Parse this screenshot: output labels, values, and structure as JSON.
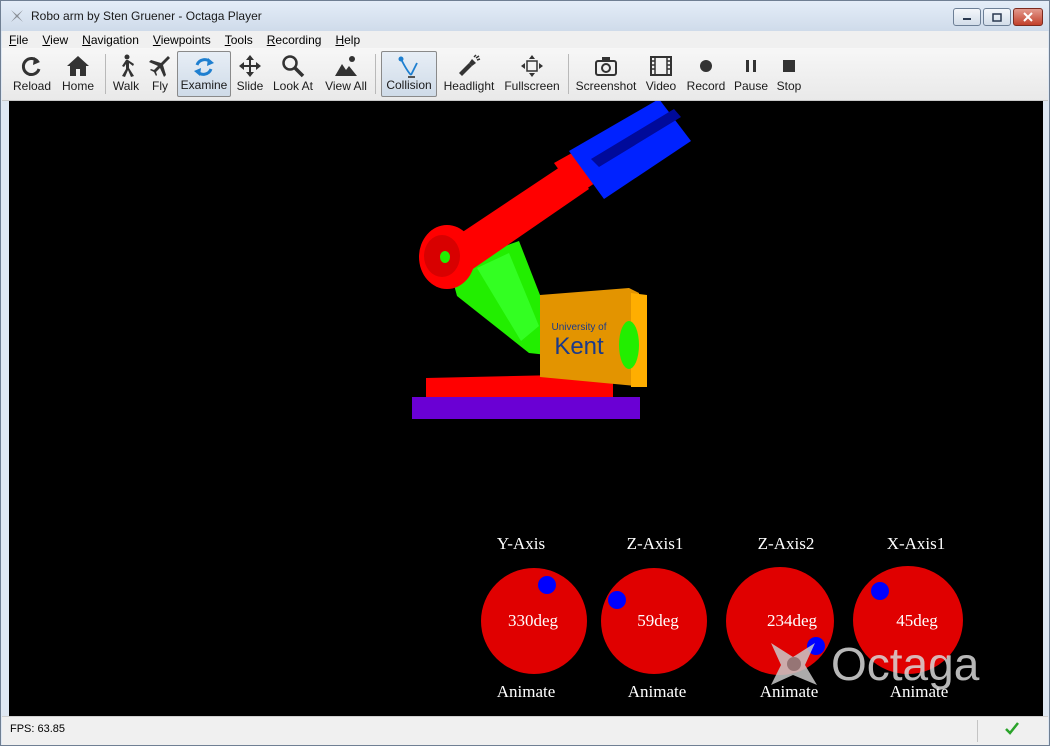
{
  "window": {
    "title": "Robo arm by Sten Gruener - Octaga Player"
  },
  "menu": [
    "File",
    "View",
    "Navigation",
    "Viewpoints",
    "Tools",
    "Recording",
    "Help"
  ],
  "toolbar": {
    "reload": "Reload",
    "home": "Home",
    "walk": "Walk",
    "fly": "Fly",
    "examine": "Examine",
    "slide": "Slide",
    "look_at": "Look At",
    "view_all": "View All",
    "collision": "Collision",
    "headlight": "Headlight",
    "fullscreen": "Fullscreen",
    "screenshot": "Screenshot",
    "video": "Video",
    "record": "Record",
    "pause": "Pause",
    "stop": "Stop"
  },
  "scene": {
    "logo_text": "University of Kent",
    "watermark": "Octaga",
    "dials": [
      {
        "axis": "Y-Axis",
        "value": "330deg",
        "animate": "Animate"
      },
      {
        "axis": "Z-Axis1",
        "value": "59deg",
        "animate": "Animate"
      },
      {
        "axis": "Z-Axis2",
        "value": "234deg",
        "animate": "Animate"
      },
      {
        "axis": "X-Axis1",
        "value": "45deg",
        "animate": "Animate"
      }
    ],
    "colors": {
      "background": "#000000",
      "arm_red": "#ff0000",
      "arm_green": "#22ee00",
      "gripper_blue": "#0022ff",
      "base_purple": "#6a00d4",
      "panel_orange": "#e39400",
      "dial_red": "#e00000",
      "dial_knob": "#0000ff"
    }
  },
  "status": {
    "fps": "FPS: 63.85"
  }
}
